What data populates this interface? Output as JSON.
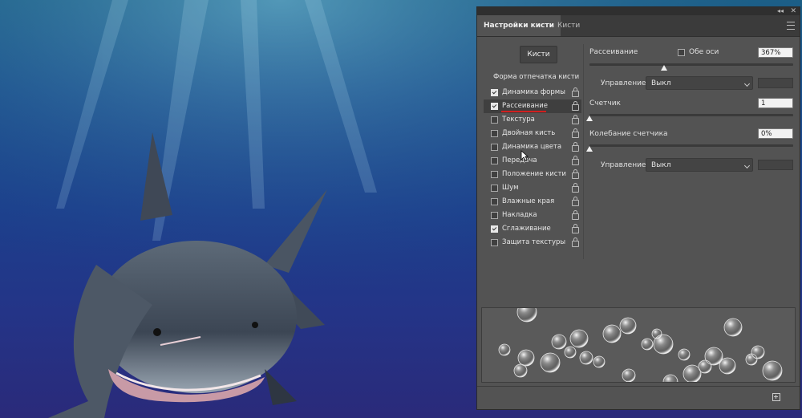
{
  "panel": {
    "tabs": [
      {
        "label": "Настройки кисти",
        "active": true
      },
      {
        "label": "Кисти",
        "active": false
      }
    ],
    "brushes_button": "Кисти",
    "section_label": "Форма отпечатка кисти",
    "options": [
      {
        "label": "Динамика формы",
        "checked": true
      },
      {
        "label": "Рассеивание",
        "checked": true,
        "selected": true
      },
      {
        "label": "Текстура",
        "checked": false
      },
      {
        "label": "Двойная кисть",
        "checked": false
      },
      {
        "label": "Динамика цвета",
        "checked": false
      },
      {
        "label": "Передача",
        "checked": false
      },
      {
        "label": "Положение кисти",
        "checked": false
      },
      {
        "label": "Шум",
        "checked": false
      },
      {
        "label": "Влажные края",
        "checked": false
      },
      {
        "label": "Накладка",
        "checked": false
      },
      {
        "label": "Сглаживание",
        "checked": true
      },
      {
        "label": "Защита текстуры",
        "checked": false
      }
    ],
    "scatter": {
      "label": "Рассеивание",
      "both_axes_label": "Обе оси",
      "both_axes_checked": false,
      "value": "367%",
      "slider_fraction": 0.367
    },
    "control1": {
      "label": "Управление:",
      "value": "Выкл"
    },
    "count": {
      "label": "Счетчик",
      "value": "1",
      "slider_fraction": 0.0
    },
    "count_jitter": {
      "label": "Колебание счетчика",
      "value": "0%",
      "slider_fraction": 0.0
    },
    "control2": {
      "label": "Управление:",
      "value": "Выкл"
    }
  },
  "colors": {
    "panel_bg": "#535353",
    "selected_row": "#3f3f3f",
    "underline": "#d02020"
  }
}
